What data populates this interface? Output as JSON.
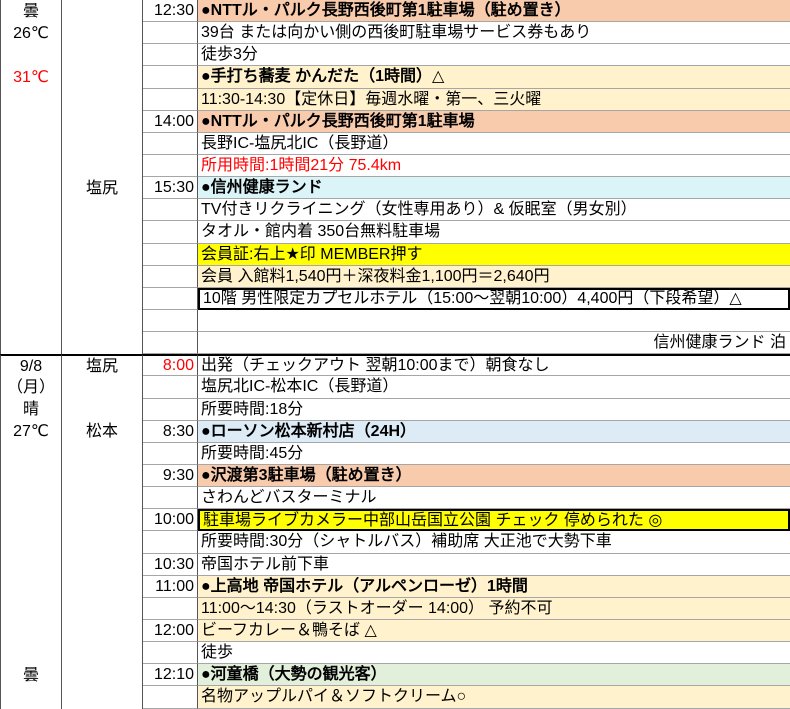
{
  "colors": {
    "orange": "#f8cbad",
    "cream": "#fff2cc",
    "yellow": "#ffff00",
    "cyan": "#daf4f8",
    "blue": "#ddebf7",
    "green": "#e2efda",
    "red": "#ff0000"
  },
  "rows": [
    {
      "day_info": "曇",
      "time": "12:30",
      "text": "●NTTル・パルク長野西後町第1駐車場（駐め置き）",
      "fill": "orange",
      "bold": true
    },
    {
      "day_info": "26℃",
      "text": "39台 または向かい側の西後町駐車場サービス券もあり"
    },
    {
      "text": "徒歩3分"
    },
    {
      "day_info": "31℃",
      "day_info_color": "red",
      "text": "●手打ち蕎麦 かんだた（1時間）△",
      "fill": "cream",
      "bold": true
    },
    {
      "text": "11:30-14:30【定休日】毎週水曜・第一、三火曜",
      "fill": "cream"
    },
    {
      "time": "14:00",
      "text": "●NTTル・パルク長野西後町第1駐車場",
      "fill": "orange",
      "bold": true
    },
    {
      "text": "長野IC-塩尻北IC（長野道）"
    },
    {
      "text": "所用時間:1時間21分 75.4km",
      "text_color": "red"
    },
    {
      "place": "塩尻",
      "time": "15:30",
      "text": "●信州健康ランド",
      "fill": "cyan",
      "bold": true
    },
    {
      "text": "TV付きリクライニング（女性専用あり）& 仮眠室（男女別）"
    },
    {
      "text": "タオル・館内着 350台無料駐車場"
    },
    {
      "text": "会員証:右上★印 MEMBER押す",
      "fill": "yellow"
    },
    {
      "text": "会員 入館料1,540円＋深夜料金1,100円＝2,640円",
      "fill": "cream"
    },
    {
      "text": "10階 男性限定カプセルホテル（15:00～翌朝10:00）4,400円（下段希望）△",
      "box": true
    },
    {},
    {
      "text": "信州健康ランド 泊",
      "align": "right"
    },
    {
      "day_info": "9/8",
      "place": "塩尻",
      "time": "8:00",
      "time_color": "red",
      "text": "出発（チェックアウト 翌朝10:00まで）朝食なし",
      "separator": true
    },
    {
      "day_info": "（月）",
      "text": "塩尻北IC-松本IC（長野道）"
    },
    {
      "day_info": "晴",
      "text": "所要時間:18分"
    },
    {
      "day_info": "27℃",
      "place": "松本",
      "time": "8:30",
      "text": "●ローソン松本新村店（24H）",
      "fill": "blue",
      "bold": true
    },
    {
      "text": "所要時間:45分"
    },
    {
      "time": "9:30",
      "text": "●沢渡第3駐車場（駐め置き）",
      "fill": "orange",
      "bold": true
    },
    {
      "text": "さわんどバスターミナル"
    },
    {
      "time": "10:00",
      "text": "駐車場ライブカメラー中部山岳国立公園 チェック 停められた ◎",
      "fill": "yellow",
      "box": true
    },
    {
      "text": "所要時間:30分（シャトルバス）補助席 大正池で大勢下車"
    },
    {
      "time": "10:30",
      "text": "帝国ホテル前下車"
    },
    {
      "time": "11:00",
      "text": "●上高地 帝国ホテル（アルペンローゼ）1時間",
      "fill": "cream",
      "bold": true
    },
    {
      "text": "11:00～14:30（ラストオーダー 14:00） 予約不可",
      "fill": "cream"
    },
    {
      "time": "12:00",
      "text": "ビーフカレー＆鴨そば △",
      "fill": "cream"
    },
    {
      "text": "徒歩"
    },
    {
      "day_info": "曇",
      "time": "12:10",
      "text": "●河童橋（大勢の観光客）",
      "fill": "green",
      "bold": true
    },
    {
      "text": "名物アップルパイ＆ソフトクリーム○",
      "fill": "cream"
    }
  ]
}
